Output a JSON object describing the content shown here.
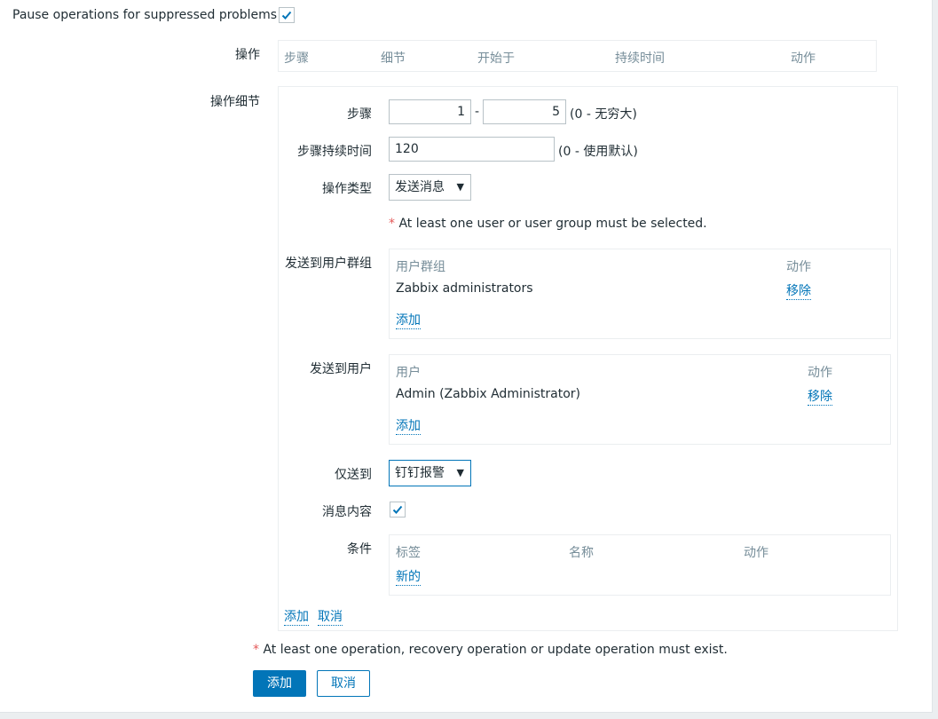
{
  "pause": {
    "label": "Pause operations for suppressed problems",
    "checked": true
  },
  "operations": {
    "label": "操作",
    "columns": [
      "步骤",
      "细节",
      "开始于",
      "持续时间",
      "动作"
    ]
  },
  "details": {
    "label": "操作细节",
    "steps": {
      "label": "步骤",
      "from": "1",
      "separator": "-",
      "to": "5",
      "hint": "(0 - 无穷大)"
    },
    "step_duration": {
      "label": "步骤持续时间",
      "value": "120",
      "hint": "(0 - 使用默认)"
    },
    "op_type": {
      "label": "操作类型",
      "value": "发送消息"
    },
    "warning": {
      "star": "*",
      "text": "At least one user or user group must be selected."
    },
    "user_groups": {
      "label": "发送到用户群组",
      "col_group": "用户群组",
      "col_action": "动作",
      "rows": [
        {
          "name": "Zabbix administrators",
          "action": "移除"
        }
      ],
      "add": "添加"
    },
    "users": {
      "label": "发送到用户",
      "col_user": "用户",
      "col_action": "动作",
      "rows": [
        {
          "name": "Admin (Zabbix Administrator)",
          "action": "移除"
        }
      ],
      "add": "添加"
    },
    "send_only": {
      "label": "仅送到",
      "value": "钉钉报警"
    },
    "message": {
      "label": "消息内容",
      "checked": true
    },
    "conditions": {
      "label": "条件",
      "col_label": "标签",
      "col_name": "名称",
      "col_action": "动作",
      "new_link": "新的"
    },
    "add_link": "添加",
    "cancel_link": "取消"
  },
  "footer": {
    "star": "*",
    "warning": "At least one operation, recovery operation or update operation must exist.",
    "add_button": "添加",
    "cancel_button": "取消"
  },
  "colors": {
    "accent": "#0275b8",
    "required": "#e45959",
    "muted": "#768d99"
  }
}
